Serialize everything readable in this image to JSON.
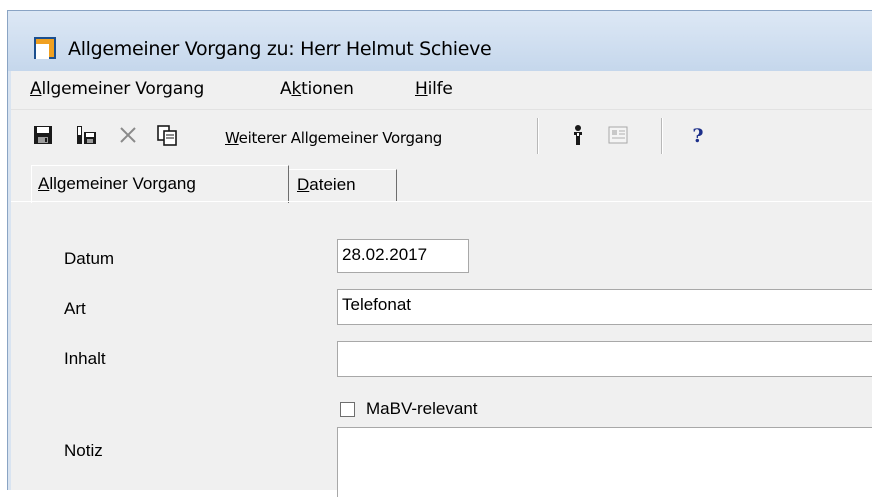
{
  "window": {
    "title": "Allgemeiner Vorgang zu: Herr Helmut Schieve",
    "icon": "app-window-icon"
  },
  "menubar": {
    "items": [
      {
        "accel": "A",
        "rest": "llgemeiner Vorgang"
      },
      {
        "pre": "A",
        "accel": "k",
        "rest": "tionen"
      },
      {
        "accel": "H",
        "rest": "ilfe"
      }
    ]
  },
  "toolbar": {
    "icons": [
      "save-icon",
      "save-close-icon",
      "delete-icon",
      "copy-icon",
      "person-info-icon",
      "document-icon",
      "help-icon"
    ],
    "weiterer_accel": "W",
    "weiterer_rest": "eiterer Allgemeiner Vorgang",
    "help_glyph": "?"
  },
  "tabs": [
    {
      "accel": "A",
      "rest": "llgemeiner Vorgang",
      "active": true
    },
    {
      "accel": "D",
      "rest": "ateien",
      "active": false
    }
  ],
  "form": {
    "datum_label": "Datum",
    "datum_value": "28.02.2017",
    "art_label": "Art",
    "art_value": "Telefonat",
    "inhalt_label": "Inhalt",
    "inhalt_value": "",
    "mabv_label": "MaBV-relevant",
    "mabv_checked": false,
    "notiz_label": "Notiz",
    "notiz_value": ""
  },
  "colors": {
    "titlebar": "#c5d7ec",
    "client": "#f0f0f0",
    "help_blue": "#1c2f8a"
  }
}
